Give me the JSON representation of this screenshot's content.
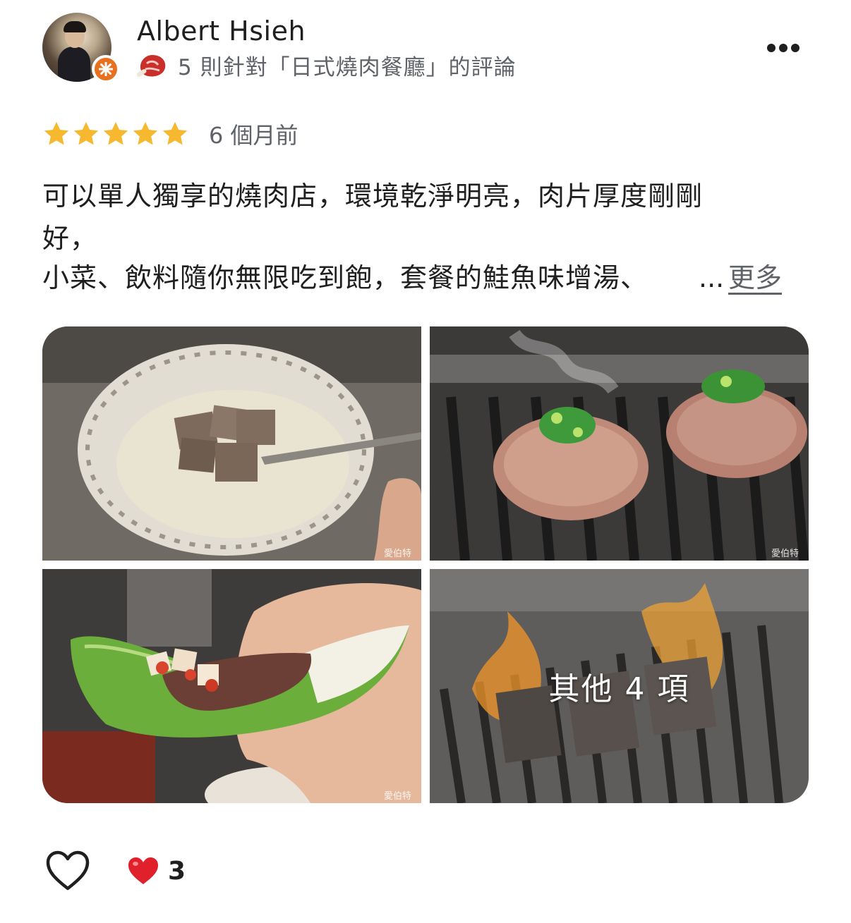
{
  "author": {
    "name": "Albert Hsieh",
    "review_count_text": "5 則針對「日式燒肉餐廳」的評論",
    "badge_icon": "local-guide-star-icon",
    "category_icon": "meat-icon",
    "avatar_icon": "avatar"
  },
  "review": {
    "rating": 5,
    "max_rating": 5,
    "date": "6 個月前",
    "text_lines": [
      "可以單人獨享的燒肉店，環境乾淨明亮，肉片厚度剛剛",
      "好，",
      "小菜、飲料隨你無限吃到飽，套餐的鮭魚味增湯、"
    ],
    "ellipsis": "...",
    "more_label": "更多"
  },
  "photos": {
    "watermark": "愛伯特",
    "more_photos_label": "其他 4 項",
    "items": [
      {
        "subject": "milk-soup-with-beef-cubes"
      },
      {
        "subject": "grilled-beef-tongue-with-scallion"
      },
      {
        "subject": "beef-lettuce-wrap-with-kimchi"
      },
      {
        "subject": "flame-grilled-meat"
      }
    ]
  },
  "actions": {
    "like_icon": "heart-outline-icon",
    "reaction_icon": "red-heart-icon",
    "reaction_count": "3"
  },
  "colors": {
    "star": "#f5b82e",
    "secondary_text": "#5f6368",
    "badge": "#e8711f",
    "heart": "#e0202a"
  }
}
